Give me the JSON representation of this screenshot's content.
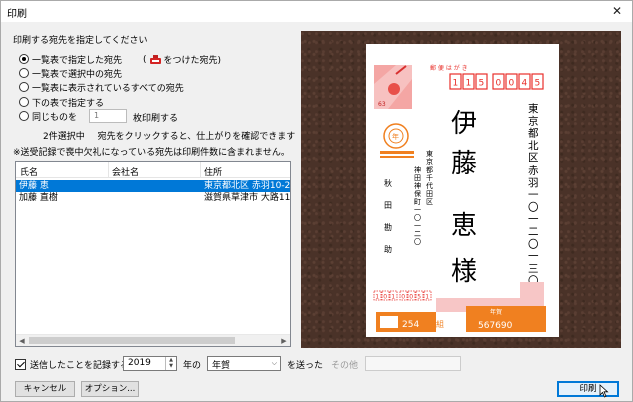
{
  "window": {
    "title": "印刷",
    "close_glyph": "✕"
  },
  "target": {
    "label": "印刷する宛先を指定してください",
    "options": [
      {
        "label": "一覧表で指定した宛先",
        "selected": true
      },
      {
        "label": "一覧表で選択中の宛先",
        "selected": false
      },
      {
        "label": "一覧表に表示されているすべての宛先",
        "selected": false
      },
      {
        "label": "下の表で指定する",
        "selected": false
      },
      {
        "label": "同じものを",
        "selected": false
      }
    ],
    "marked_open": "(",
    "marked_label": "をつけた宛先)",
    "copies_value": "1",
    "copies_suffix": "枚印刷する",
    "selected_count": "2件選択中",
    "selected_hint": "宛先をクリックすると、仕上がりを確認できます",
    "note": "※送受記録で喪中欠礼になっている宛先は印刷件数に含まれません。"
  },
  "table": {
    "headers": [
      "氏名",
      "会社名",
      "住所"
    ],
    "rows": [
      {
        "name": "伊藤 恵",
        "company": "",
        "address": "東京都北区 赤羽10-2",
        "selected": true
      },
      {
        "name": "加藤 直樹",
        "company": "",
        "address": "滋賀県草津市 大路11",
        "selected": false
      }
    ],
    "scroll_left": "◀",
    "scroll_right": "▶"
  },
  "postcard": {
    "header": "郵 便 は が き",
    "postal_code": [
      "1",
      "1",
      "5",
      "0",
      "0",
      "4",
      "5"
    ],
    "recipient_address": "東京都北区赤羽一〇一二〇一三〇四",
    "recipient_name_1": "伊",
    "recipient_name_2": "藤",
    "recipient_name_3": "恵",
    "recipient_honorific": "様",
    "sender_address_1": "東京都千代田区",
    "sender_address_2": "神田神保町一〇一二〇",
    "sender_name": [
      "秋",
      "田",
      "勘",
      "助"
    ],
    "sender_postal": [
      "1",
      "0",
      "1",
      "0",
      "0",
      "5",
      "1"
    ],
    "stamp_value": "63",
    "lottery_left": "254",
    "lottery_right": "567690",
    "lottery_unit": "組",
    "lottery_mark": "年賀",
    "stamp_mark": "年"
  },
  "options": {
    "record_label": "送信したことを記録する",
    "record_checked": true,
    "year_value": "2019",
    "year_suffix": "年の",
    "type_value": "年賀",
    "sent_label": "を送った",
    "other_label": "その他"
  },
  "buttons": {
    "cancel": "キャンセル",
    "options": "オプション...",
    "print": "印刷"
  },
  "colors": {
    "accent": "#0078d7",
    "postal_red": "#e8302b",
    "preview_bg": "#4a3228"
  }
}
